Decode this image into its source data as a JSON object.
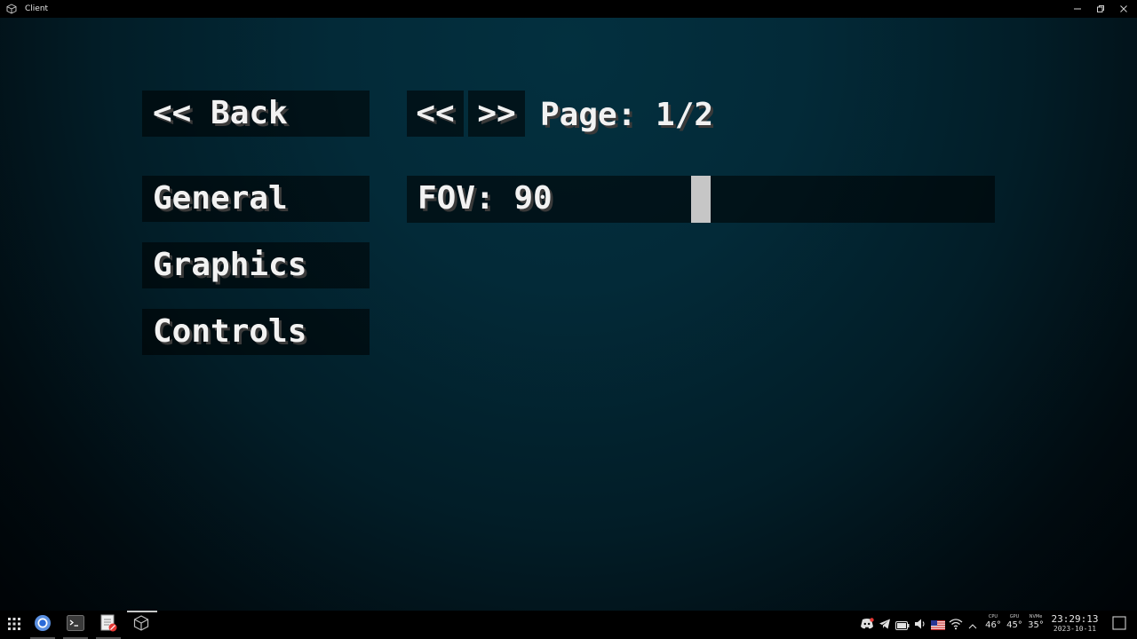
{
  "window": {
    "title": "Client",
    "app_icon": "cube-icon",
    "controls": [
      "minimize-icon",
      "restore-icon",
      "close-icon"
    ]
  },
  "menu": {
    "back_label": "<< Back",
    "categories": [
      "General",
      "Graphics",
      "Controls"
    ]
  },
  "pager": {
    "prev_label": "<<",
    "next_label": ">>",
    "page_text": "Page: 1/2"
  },
  "settings": {
    "fov": {
      "label": "FOV: 90",
      "value": 90,
      "slider_fraction": 0.5
    }
  },
  "taskbar": {
    "apps": [
      "start-grid-icon",
      "chrome-icon",
      "terminal-icon",
      "notepad-icon",
      "cube-app-icon"
    ],
    "tray_icons": [
      "discord-icon",
      "telegram-icon",
      "battery-icon",
      "volume-icon",
      "us-flag-icon",
      "wifi-icon",
      "chevron-up-icon"
    ],
    "sensors": [
      {
        "label": "CPU",
        "value": "46°"
      },
      {
        "label": "GPU",
        "value": "45°"
      },
      {
        "label": "NVMe",
        "value": "35°"
      }
    ],
    "clock": {
      "time": "23:29:13",
      "date": "2023-10-11"
    },
    "notification_icon": "notification-square-icon"
  },
  "colors": {
    "background_center": "#03303f",
    "background_edge": "#000407",
    "button_bg": "#000000",
    "text": "#f2f2f2",
    "slider_knob": "#c6c6c6"
  }
}
